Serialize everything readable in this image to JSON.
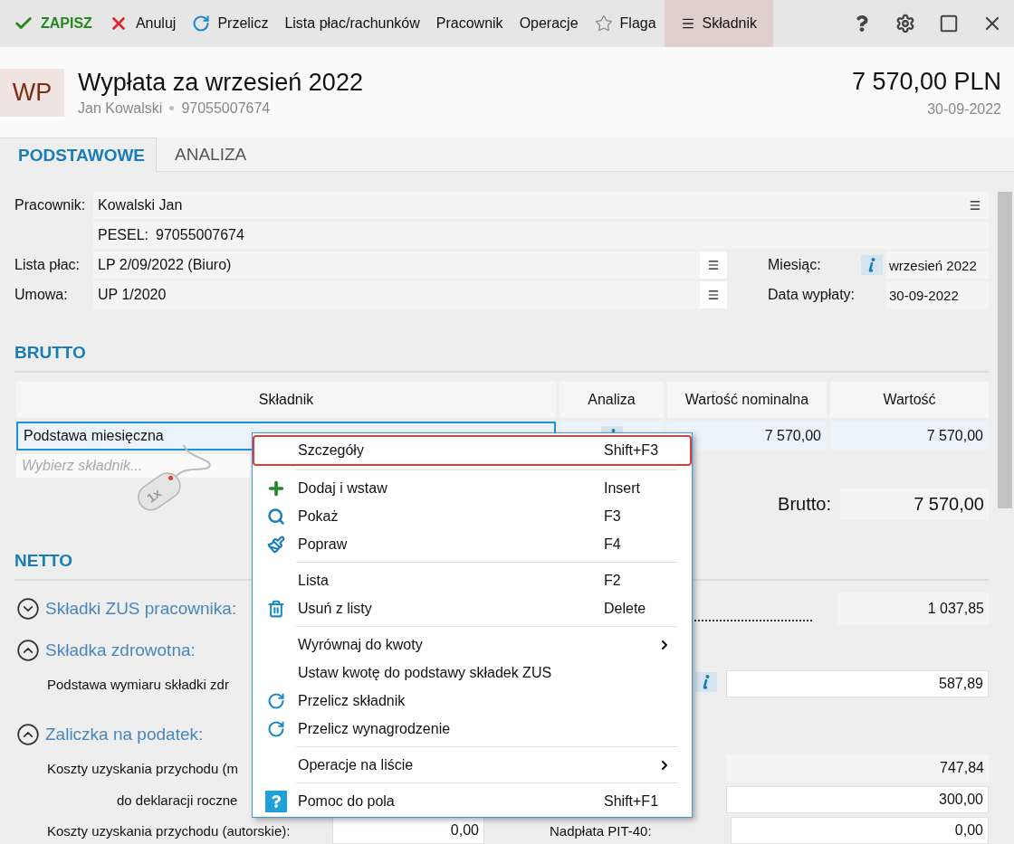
{
  "toolbar": [
    {
      "kind": "save",
      "label": "ZAPISZ",
      "selected": false
    },
    {
      "kind": "cancel",
      "label": "Anuluj",
      "selected": false
    },
    {
      "kind": "refresh",
      "label": "Przelicz",
      "selected": false
    },
    {
      "kind": "plain",
      "label": "Lista płac/rachunków",
      "selected": false
    },
    {
      "kind": "plain",
      "label": "Pracownik",
      "selected": false
    },
    {
      "kind": "plain",
      "label": "Operacje",
      "selected": false
    },
    {
      "kind": "star",
      "label": "Flaga",
      "selected": false
    },
    {
      "kind": "menu",
      "label": "Składnik",
      "selected": true
    }
  ],
  "window_buttons": [
    {
      "kind": "help"
    },
    {
      "kind": "settings"
    },
    {
      "kind": "maximize"
    },
    {
      "kind": "close"
    }
  ],
  "header": {
    "badge": "WP",
    "title": "Wypłata za wrzesień 2022",
    "person": "Jan Kowalski",
    "pesel": "97055007674",
    "amount": "7 570,00 PLN",
    "date": "30-09-2022"
  },
  "tabs": [
    {
      "label": "PODSTAWOWE",
      "selected": true
    },
    {
      "label": "ANALIZA",
      "selected": false
    }
  ],
  "form": {
    "employee": {
      "label": "Pracownik:",
      "value": "Kowalski Jan",
      "pesel_label": "PESEL:",
      "pesel": "97055007674"
    },
    "payroll": {
      "label": "Lista płac:",
      "value": "LP 2/09/2022 (Biuro)"
    },
    "contract": {
      "label": "Umowa:",
      "value": "UP 1/2020"
    },
    "month": {
      "label": "Miesiąc:",
      "value": "wrzesień 2022"
    },
    "pay_date": {
      "label": "Data wypłaty:",
      "value": "30-09-2022"
    }
  },
  "brutto": {
    "title": "BRUTTO",
    "columns": [
      "Składnik",
      "Analiza",
      "Wartość nominalna",
      "Wartość"
    ],
    "rows": [
      {
        "name": "Podstawa miesięczna",
        "nominal": "7 570,00",
        "value": "7 570,00",
        "selected": true
      }
    ],
    "placeholder": "Wybierz składnik...",
    "total_label": "Brutto:",
    "total": "7 570,00"
  },
  "netto": {
    "title": "NETTO",
    "groups": [
      {
        "title": "Składki ZUS pracownika:",
        "expanded": false,
        "value": "1 037,85"
      },
      {
        "title": "Składka zdrowotna:",
        "expanded": true,
        "rows": [
          {
            "kind": "main",
            "label": "Podstawa wymiaru składki zdr",
            "info": true,
            "editable": true,
            "value": "587,89"
          }
        ]
      },
      {
        "title": "Zaliczka na podatek:",
        "expanded": true,
        "rows": [
          {
            "kind": "main",
            "label": "Koszty uzyskania przychodu (m",
            "info": false,
            "editable": false,
            "value": "747,84"
          },
          {
            "kind": "sub",
            "label": "do deklaracji roczne",
            "info": false,
            "editable": true,
            "value": "300,00"
          }
        ]
      }
    ],
    "pair": {
      "label": "Koszty uzyskania przychodu (autorskie):",
      "value": "0,00",
      "label_2": "Nadpłata PIT-40:",
      "value_2": "0,00"
    }
  },
  "click_hint": {
    "label": "1x"
  },
  "context_menu": [
    {
      "kind": "plain",
      "label": "Szczegóły",
      "shortcut": "Shift+F3",
      "selected": true
    },
    {
      "kind": "separator"
    },
    {
      "kind": "add",
      "label": "Dodaj i wstaw",
      "shortcut": "Insert",
      "selected": false
    },
    {
      "kind": "search",
      "label": "Pokaż",
      "shortcut": "F3",
      "selected": false
    },
    {
      "kind": "edit",
      "label": "Popraw",
      "shortcut": "F4",
      "selected": false
    },
    {
      "kind": "separator"
    },
    {
      "kind": "plain",
      "label": "Lista",
      "shortcut": "F2",
      "selected": false
    },
    {
      "kind": "delete",
      "label": "Usuń z listy",
      "shortcut": "Delete",
      "selected": false
    },
    {
      "kind": "separator"
    },
    {
      "kind": "submenu",
      "label": "Wyrównaj do kwoty",
      "selected": false
    },
    {
      "kind": "plain",
      "label": "Ustaw kwotę do podstawy składek ZUS",
      "selected": false
    },
    {
      "kind": "refresh",
      "label": "Przelicz składnik",
      "selected": false
    },
    {
      "kind": "refresh",
      "label": "Przelicz wynagrodzenie",
      "selected": false
    },
    {
      "kind": "separator"
    },
    {
      "kind": "submenu",
      "label": "Operacje na liście",
      "selected": false
    },
    {
      "kind": "separator"
    },
    {
      "kind": "help",
      "label": "Pomoc do pola",
      "shortcut": "Shift+F1",
      "selected": false
    }
  ]
}
